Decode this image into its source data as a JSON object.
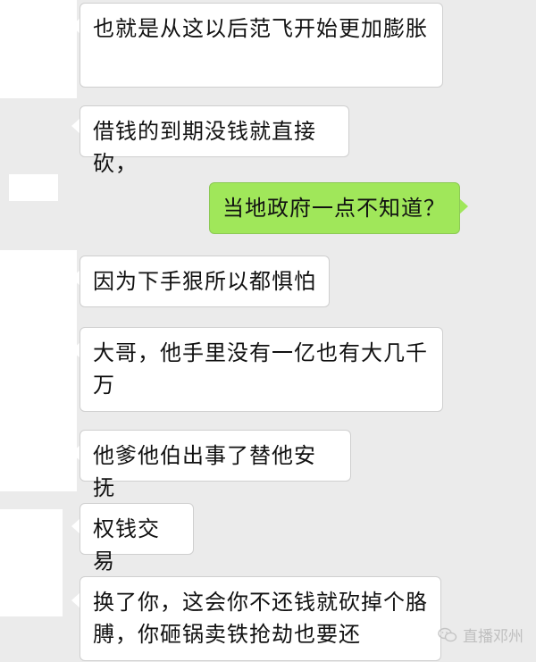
{
  "messages": [
    {
      "side": "left",
      "text": "也就是从这以后范飞开始更加膨胀"
    },
    {
      "side": "left",
      "text": "借钱的到期没钱就直接砍，"
    },
    {
      "side": "right",
      "text": "当地政府一点不知道？"
    },
    {
      "side": "left",
      "text": "因为下手狠所以都惧怕"
    },
    {
      "side": "left",
      "text": "大哥，他手里没有一亿也有大几千万"
    },
    {
      "side": "left",
      "text": "他爹他伯出事了替他安抚"
    },
    {
      "side": "left",
      "text": "权钱交易"
    },
    {
      "side": "left",
      "text": "换了你，这会你不还钱就砍掉个胳膊，你砸锅卖铁抢劫也要还"
    }
  ],
  "watermark": {
    "text": "直播邓州",
    "icon": "wechat-icon"
  },
  "colors": {
    "background": "#ebebeb",
    "incoming_bubble": "#ffffff",
    "outgoing_bubble": "#a0e75a"
  }
}
